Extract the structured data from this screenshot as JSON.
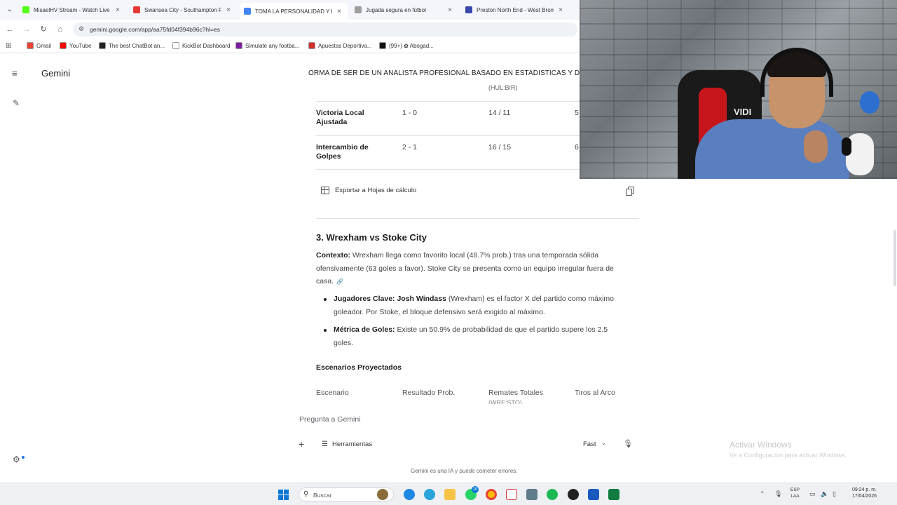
{
  "browser": {
    "tabs": [
      {
        "title": "MisaelHV Stream - Watch Live",
        "color": "#53fc18",
        "active": false
      },
      {
        "title": "Swansea City - Southampton F",
        "color": "#e53935",
        "active": false
      },
      {
        "title": "TOMA LA PERSONALIDAD Y LA",
        "color": "#4285f4",
        "active": true
      },
      {
        "title": "Jugada segura en fútbol",
        "color": "#9e9e9e",
        "active": false
      },
      {
        "title": "Preston North End - West Brom",
        "color": "#3949ab",
        "active": false
      }
    ],
    "url": "gemini.google.com/app/aa75fd04f394b96c?hl=es",
    "bookmarks": [
      {
        "label": "Gmail",
        "color": "#ea4335"
      },
      {
        "label": "YouTube",
        "color": "#ff0000"
      },
      {
        "label": "The best ChatBot an...",
        "color": "#222222"
      },
      {
        "label": "KickBot Dashboard",
        "color": "#ffffff"
      },
      {
        "label": "Simulate any footba...",
        "color": "#7b1fa2"
      },
      {
        "label": "Apuestas Deportiva...",
        "color": "#d32f2f"
      },
      {
        "label": "(99+) ✿ Abogad...",
        "color": "#111111"
      }
    ]
  },
  "sidebar": {
    "brand": "Gemini"
  },
  "conversation": {
    "title": "ORMA DE SER DE UN ANALISTA PROFESIONAL BASADO EN ESTADISTICAS Y D",
    "cut_header": "(HUL:BIR)",
    "previous_table_rows": [
      {
        "scenario": "Victoria Local Ajustada",
        "result": "1 - 0",
        "shots": "14 / 11",
        "on_target": "5"
      },
      {
        "scenario": "Intercambio de Golpes",
        "result": "2 - 1",
        "shots": "16 / 15",
        "on_target": "6"
      }
    ],
    "export_label": "Exportar a Hojas de cálculo",
    "section_title": "3. Wrexham vs Stoke City",
    "context_label": "Contexto:",
    "context_text": " Wrexham llega como favorito local (48.7% prob.) tras una temporada sólida ofensivamente (63 goles a favor). Stoke City se presenta como un equipo irregular fuera de casa.",
    "bullets": [
      {
        "label": "Jugadores Clave: Josh Windass",
        "text": " (Wrexham) es el factor X del partido como máximo goleador. Por Stoke, el bloque defensivo será exigido al máximo."
      },
      {
        "label": "Métrica de Goles:",
        "text": " Existe un 50.9% de probabilidad de que el partido supere los 2.5 goles."
      }
    ],
    "scenarios_title": "Escenarios Proyectados",
    "table_headers": [
      "Escenario",
      "Resultado Prob.",
      "Remates Totales",
      "Tiros al Arco"
    ],
    "table_header_sub": "(WRE:STO)"
  },
  "input": {
    "placeholder": "Pregunta a Gemini",
    "tools_label": "Herramientas",
    "mode_label": "Fast",
    "disclaimer": "Gemini es una IA y puede cometer errores."
  },
  "watermark": {
    "title": "Activar Windows",
    "subtitle": "Ve a Configuración para activar Windows."
  },
  "webcam": {
    "chair_text": "VIDI"
  },
  "taskbar": {
    "search_placeholder": "Buscar",
    "whatsapp_badge": "10",
    "lang_top": "ESP",
    "lang_bottom": "LAA",
    "time": "09:24 p. m.",
    "date": "17/04/2026"
  }
}
